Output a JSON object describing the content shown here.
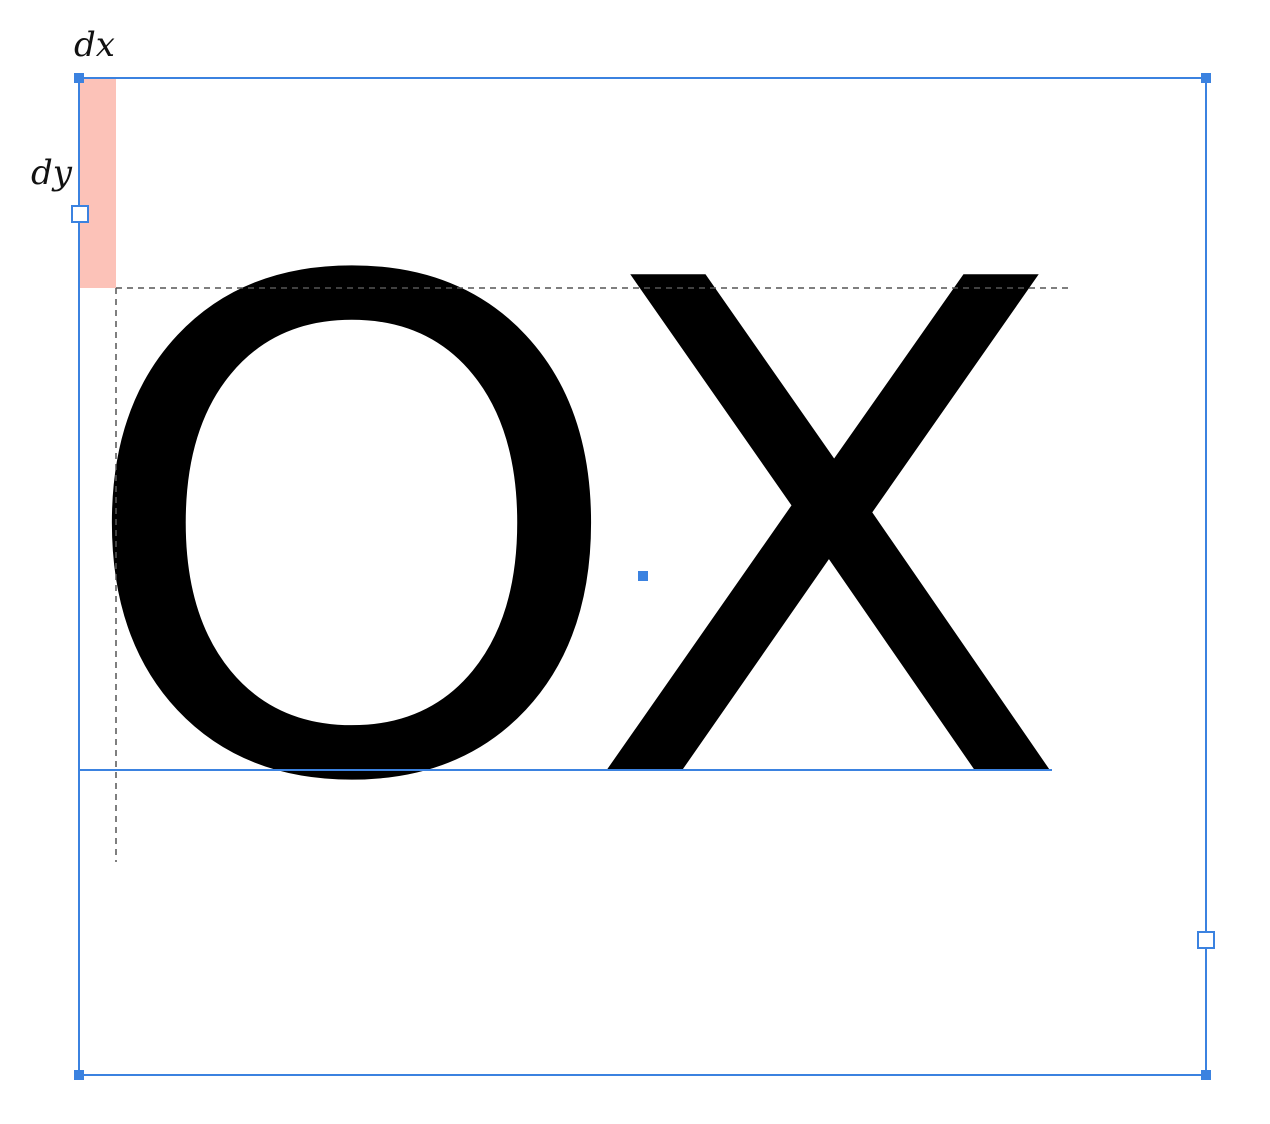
{
  "labels": {
    "dx": "dx",
    "dy": "dy"
  },
  "text": {
    "content": "OX"
  },
  "colors": {
    "frame": "#3b82e0",
    "handle_fill": "#3b82e0",
    "handle_open_fill": "#ffffff",
    "offset_highlight": "#fcc2b8",
    "guide": "#555555",
    "glyph": "#000000",
    "label": "#111111"
  },
  "icons": {
    "corner_handle": "square-handle-filled",
    "mid_handle": "square-handle-open",
    "center_point": "center-point"
  }
}
